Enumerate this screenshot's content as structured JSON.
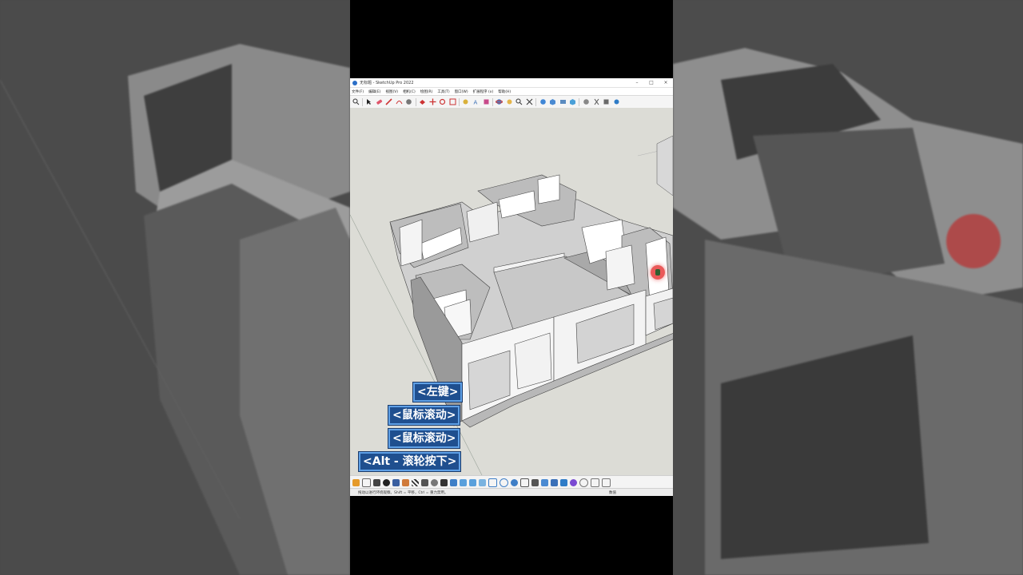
{
  "window": {
    "title": "无标题 - SketchUp Pro 2022",
    "minimize": "–",
    "maximize": "□",
    "close": "×"
  },
  "menu": [
    "文件(F)",
    "编辑(E)",
    "视图(V)",
    "相机(C)",
    "绘图(R)",
    "工具(T)",
    "窗口(W)",
    "扩展程序 (x)",
    "帮助(H)"
  ],
  "overlay_shortcuts": {
    "left_click": "<左键>",
    "scroll_1": "<鼠标滚动>",
    "scroll_2": "<鼠标滚动>",
    "alt_wheel": "<Alt - 滚轮按下>"
  },
  "status": {
    "hint": "拖动以进行环绕观察。Shift = 平移，Ctrl = 重力禁用。",
    "measure_label": "数值"
  },
  "colors": {
    "shortcut_bg": "#1f4f8f",
    "shortcut_border": "#5fa0e6",
    "viewport_bg": "#dcdcd6",
    "wall_face": "#f2f2f2",
    "wall_shade": "#8c8c8c"
  },
  "icons": {
    "toolbar": [
      "search-icon",
      "select-icon",
      "eraser-icon",
      "pencil-icon",
      "arc-icon",
      "shape-icon",
      "pushpull-icon",
      "move-icon",
      "rotate-icon",
      "scale-icon",
      "tape-icon",
      "text-icon",
      "paint-icon",
      "orbit-icon",
      "pan-icon",
      "zoom-icon",
      "zoom-extents-icon",
      "standard-views-icon",
      "style-icon",
      "section-icon",
      "xray-icon",
      "sandbox-icon",
      "warehouse-icon",
      "extension-icon",
      "layout-icon"
    ]
  }
}
